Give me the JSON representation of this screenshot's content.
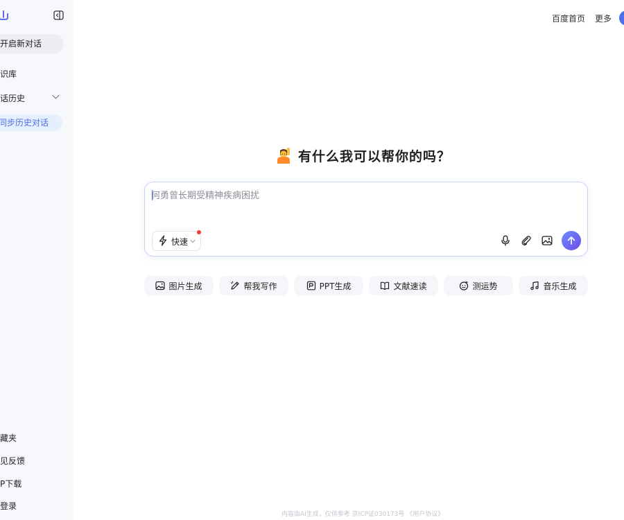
{
  "sidebar": {
    "new_chat_label": "开启新对话",
    "knowledge_base_label": "识库",
    "history_label": "话历史",
    "sync_label": "同步历史对话",
    "bottom": {
      "favorites": "藏夹",
      "feedback": "见反馈",
      "download": "P下载",
      "login": "登录"
    }
  },
  "header": {
    "home_link": "百度首页",
    "more_link": "更多"
  },
  "main": {
    "greeting": "有什么我可以帮你的吗？",
    "input": {
      "value": "",
      "placeholder": "何勇曾长期受精神疾病困扰"
    },
    "mode_label": "快速",
    "chips": [
      {
        "label": "图片生成",
        "icon": "image-gen-icon"
      },
      {
        "label": "帮我写作",
        "icon": "pen-icon"
      },
      {
        "label": "PPT生成",
        "icon": "ppt-icon"
      },
      {
        "label": "文献速读",
        "icon": "book-icon"
      },
      {
        "label": "测运势",
        "icon": "fortune-icon"
      },
      {
        "label": "音乐生成",
        "icon": "music-icon"
      }
    ]
  },
  "footer": {
    "text": "内容由AI生成，仅供参考  京ICP证030173号 ",
    "agreement": "《用户协议》"
  },
  "colors": {
    "accent": "#4e6ef2",
    "sidebar_bg": "#f6f8fc",
    "sync_pill_bg": "#e5effd",
    "send_gradient_start": "#6e8cff",
    "send_gradient_end": "#6c4de6"
  }
}
